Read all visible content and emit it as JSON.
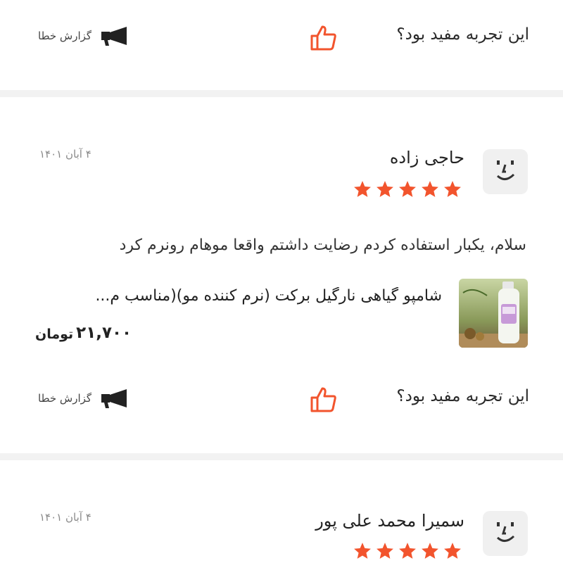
{
  "colors": {
    "accent": "#f2542d",
    "star": "#f2542d",
    "divider": "#f2f2f2",
    "muted": "#8a8a8a"
  },
  "feedback": {
    "question": "این تجربه مفید بود؟",
    "report_label": "گزارش خطا"
  },
  "reviews": [
    {
      "name": "حاجی زاده",
      "date": "۴ آبان ۱۴۰۱",
      "rating": 5,
      "body": "سلام، یکبار استفاده کردم رضایت داشتم واقعا موهام رونرم کرد",
      "product": {
        "name": "شامپو گیاهی نارگیل برکت (نرم کننده مو)(مناسب م...",
        "price": "۲۱,۷۰۰",
        "currency": "تومان"
      }
    },
    {
      "name": "سمیرا محمد علی پور",
      "date": "۴ آبان ۱۴۰۱",
      "rating": 5
    }
  ]
}
